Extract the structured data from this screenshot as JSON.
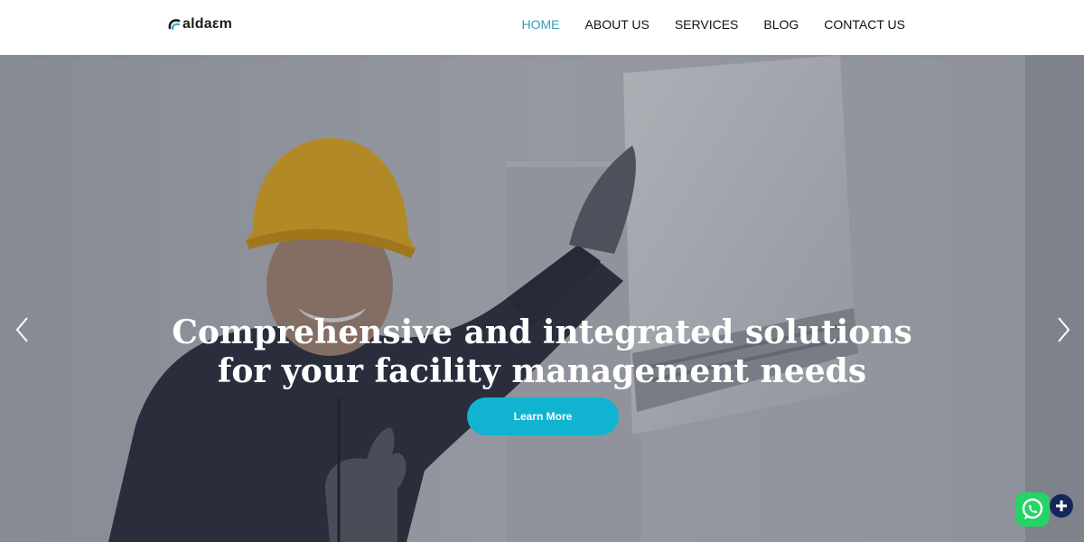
{
  "brand": {
    "logo_text": "aldaεm"
  },
  "nav": {
    "items": [
      {
        "label": "HOME",
        "active": true
      },
      {
        "label": "ABOUT US",
        "active": false
      },
      {
        "label": "SERVICES",
        "active": false
      },
      {
        "label": "BLOG",
        "active": false
      },
      {
        "label": "CONTACT US",
        "active": false
      }
    ]
  },
  "hero": {
    "title_line1": "Comprehensive and integrated solutions",
    "title_line2": "for your facility management needs",
    "cta_label": "Learn More",
    "prev_icon": "chevron-left-icon",
    "next_icon": "chevron-right-icon"
  },
  "floating": {
    "whatsapp_icon": "whatsapp-icon",
    "plus_icon": "plus-icon"
  },
  "colors": {
    "nav_active": "#3a9bb5",
    "cta": "#10b4d1",
    "whatsapp": "#25d366",
    "plus_bg": "#14275c",
    "helmet": "#f2b51e"
  }
}
